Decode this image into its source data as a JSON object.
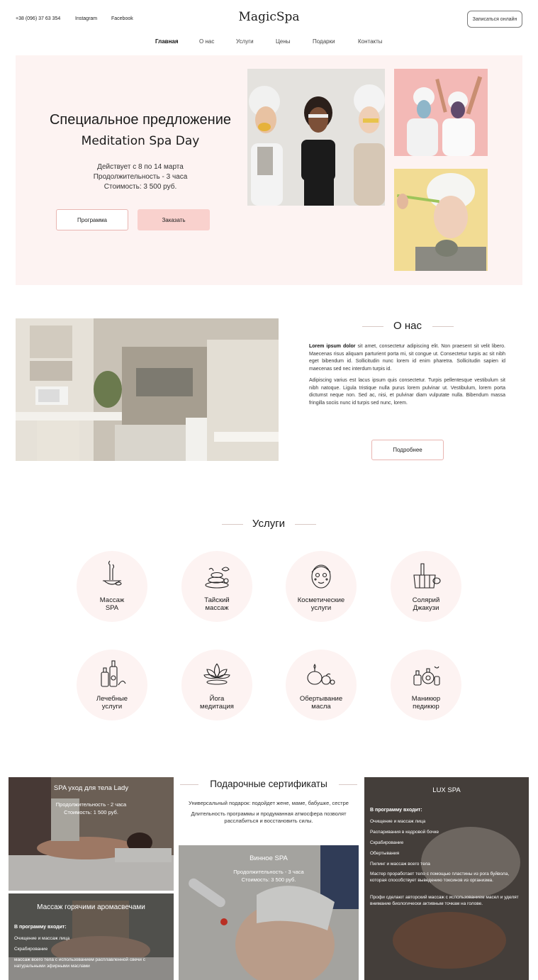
{
  "header": {
    "phone": "+38 (096) 37 63 354",
    "instagram": "Instagram",
    "facebook": "Facebook",
    "logo": "MagicSpa",
    "book_button": "Записаться онлайн"
  },
  "nav": [
    "Главная",
    "О нас",
    "Услуги",
    "Цены",
    "Подарки",
    "Контакты"
  ],
  "hero": {
    "title": "Специальное предложение",
    "subtitle": "Meditation Spa Day",
    "dates": "Действует с 8 по 14 марта",
    "duration": "Продолжительность  - 3 часа",
    "price": "Стоимость: 3 500 руб.",
    "program_button": "Программа",
    "order_button": "Заказать"
  },
  "about": {
    "title": "О нас",
    "p1_bold": "Lorem ipsum dolor",
    "p1": " sit amet, consectetur adipiscing elit. Non praesent sit velit libero. Maecenas risus aliquam parturient porta mi, sit congue ut. Consectetur turpis ac sit nibh eget bibendum id. Sollicitudin nunc lorem id enim pharetra. Sollicitudin sapien id maecenas sed nec interdum turpis id.",
    "p2": "Adipiscing varius est lacus ipsum quis consectetur. Turpis pellentesque vestibulum sit nibh natoque. Ligula tristique nulla purus lorem pulvinar ut. Vestibulum, lorem porta dictumst neque non. Sed ac, nisi, et pulvinar diam vulputate nulla. Bibendum massa fringilla sociis nunc id turpis sed nunc, lorem.",
    "more_button": "Подробнее"
  },
  "services": {
    "title": "Услуги",
    "items": [
      {
        "line1": "Массаж",
        "line2": "SPA",
        "icon": "incense-bowl-icon"
      },
      {
        "line1": "Тайский",
        "line2": "массаж",
        "icon": "massage-stones-icon"
      },
      {
        "line1": "Косметические",
        "line2": "услуги",
        "icon": "face-mask-icon"
      },
      {
        "line1": "Солярий",
        "line2": "Джакузи",
        "icon": "wooden-tub-icon"
      },
      {
        "line1": "Лечебные",
        "line2": "услуги",
        "icon": "oil-bottles-icon"
      },
      {
        "line1": "Йога",
        "line2": "медитация",
        "icon": "lotus-icon"
      },
      {
        "line1": "Обертывание",
        "line2": "масла",
        "icon": "candles-icon"
      },
      {
        "line1": "Маникюр",
        "line2": "педикюр",
        "icon": "perfume-bottles-icon"
      }
    ]
  },
  "gifts": {
    "title": "Подарочные сертификаты",
    "desc1": "Универсальный подарок: подойдет жене, маме, бабушке, сестре",
    "desc2": "Длительность программы и продуманная атмосфера позволят расслабиться и восстановить силы."
  },
  "cards": {
    "lady": {
      "title": "SPA уход для тела Lady",
      "duration": "Продолжительность  - 2 часа",
      "price": "Стоимость: 1 500 руб."
    },
    "aroma": {
      "title": "Массаж горячими аромасвечами",
      "includes": "В программу входит:",
      "items": [
        "Очищение и массаж лица",
        "Скрабирование",
        "массаж всего тела с использованием расплавленной свечи с натуральными эфирными маслами"
      ]
    },
    "wine": {
      "title": "Винное SPA",
      "duration": "Продолжительность  - 3 часа",
      "price": "Стоимость: 3 500 руб."
    },
    "lux": {
      "title": "LUX SPA",
      "includes": "В программу входит:",
      "items": [
        "Очищение и массаж лица",
        "Распаривания в кедровой бочке",
        "Скрабирование",
        "Обертывания",
        "Пилинг и массаж всего тела",
        "Мастер проработает тело с помощью пластины из рога буйвола, которая способствует выведению токсинов из организма.",
        "Профи сделают авторский массаж с использованием масел и уделят внимание биологически активным точкам на голове."
      ]
    }
  },
  "colors": {
    "accent_pink": "#fdf3f2",
    "button_pink": "#f9d1cd",
    "border_pink": "#e9b5b1"
  }
}
